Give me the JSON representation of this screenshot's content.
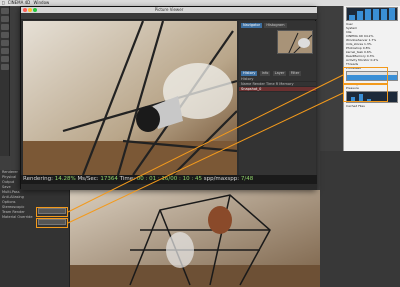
{
  "menubar": {
    "items": [
      "CINEMA 4D",
      "Window"
    ]
  },
  "picture_viewer": {
    "title": "Picture Viewer",
    "tabs": [
      "Navigator",
      "Histogram"
    ],
    "panel_tabs": [
      "History",
      "Info",
      "Layer",
      "Filter",
      "Stereo"
    ],
    "rows": [
      "History",
      "Name",
      "Render Time",
      "R",
      "Memory",
      "Snapshot_0"
    ],
    "status": {
      "prefix": "Rendering:",
      "percent": "14.28%",
      "mssec_label": "Ms/Sec:",
      "mssec": "17364",
      "time_label": "Time:",
      "time": "00 : 01 : 16/00 : 10 : 45",
      "spp_label": "spp/maxspp:",
      "spp": "7/48"
    }
  },
  "activity_monitor": {
    "rows": [
      "User",
      "System",
      "Idle",
      "CINEMA 4D",
      "WindowServer",
      "mds_stores",
      "Photoshop",
      "kernel_task",
      "ReadMemory",
      "Activity Monitor"
    ],
    "values": [
      "",
      "",
      "",
      "94.2%",
      "1.7%",
      "1.3%",
      "0.8%",
      "0.6%",
      "0.3%",
      "0.2%"
    ],
    "labels": [
      "Threads",
      "Processes",
      "Memory",
      "Pressure",
      "Cached Files"
    ]
  },
  "left_panel": {
    "rows": [
      "Renderer",
      "Physical",
      "Output",
      "Save",
      "Multi-Pass",
      "Anti-Aliasing",
      "Options",
      "Stereoscopic",
      "Team Render",
      "Material Override"
    ]
  },
  "highlight_color": "#f39a1c"
}
